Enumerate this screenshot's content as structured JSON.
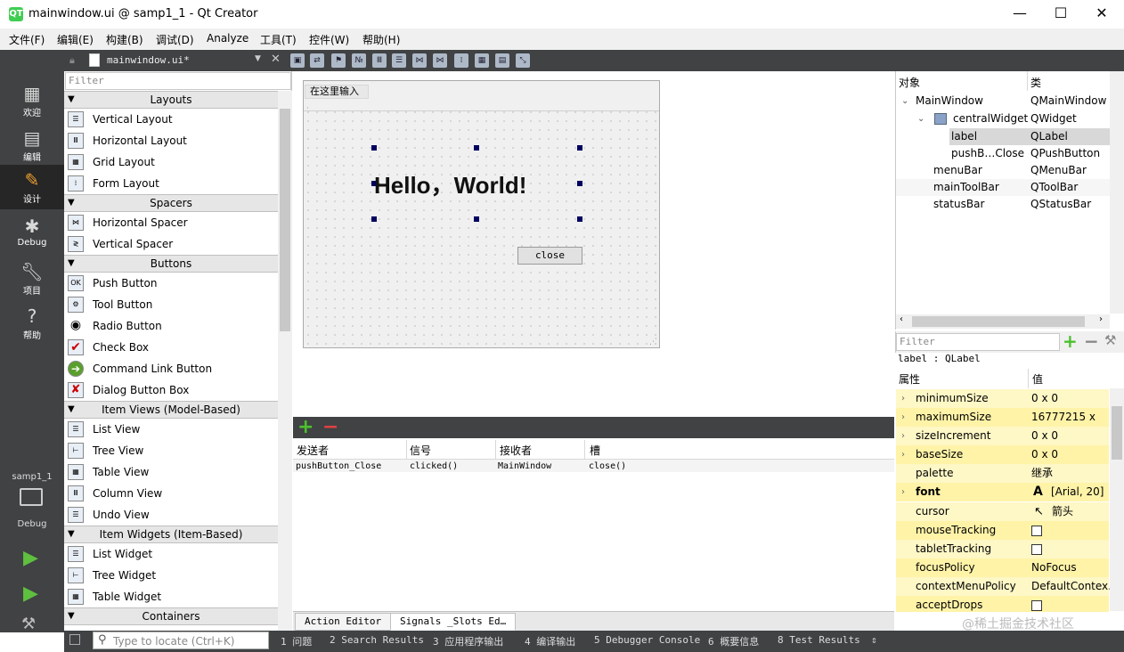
{
  "window": {
    "title": "mainwindow.ui @ samp1_1 - Qt Creator",
    "app_icon": "QT",
    "min": "—",
    "max": "☐",
    "close": "✕"
  },
  "menu": [
    "文件(F)",
    "编辑(E)",
    "构建(B)",
    "调试(D)",
    "Analyze",
    "工具(T)",
    "控件(W)",
    "帮助(H)"
  ],
  "modes": [
    {
      "label": "欢迎",
      "icon": "grid-icon"
    },
    {
      "label": "编辑",
      "icon": "doc-icon"
    },
    {
      "label": "设计",
      "icon": "pen-icon"
    },
    {
      "label": "Debug",
      "icon": "bug-icon"
    },
    {
      "label": "项目",
      "icon": "wrench-icon"
    },
    {
      "label": "帮助",
      "icon": "help-icon"
    }
  ],
  "kit": {
    "project": "samp1_1",
    "mode": "Debug"
  },
  "editor": {
    "file": "mainwindow.ui*"
  },
  "widgetbox": {
    "filter_placeholder": "Filter",
    "cat_layouts": "Layouts",
    "layouts": [
      "Vertical Layout",
      "Horizontal Layout",
      "Grid Layout",
      "Form Layout"
    ],
    "cat_spacers": "Spacers",
    "spacers": [
      "Horizontal Spacer",
      "Vertical Spacer"
    ],
    "cat_buttons": "Buttons",
    "buttons": [
      "Push Button",
      "Tool Button",
      "Radio Button",
      "Check Box",
      "Command Link Button",
      "Dialog Button Box"
    ],
    "cat_itemviews": "Item Views (Model-Based)",
    "itemviews": [
      "List View",
      "Tree View",
      "Table View",
      "Column View",
      "Undo View"
    ],
    "cat_itemwidgets": "Item Widgets (Item-Based)",
    "itemwidgets": [
      "List Widget",
      "Tree Widget",
      "Table Widget"
    ],
    "cat_containers": "Containers"
  },
  "form": {
    "menu_placeholder": "在这里输入",
    "label_text": "Hello，World!",
    "button_text": "close"
  },
  "signals": {
    "headers": [
      "发送者",
      "信号",
      "接收者",
      "槽"
    ],
    "row": [
      "pushButton_Close",
      "clicked()",
      "MainWindow",
      "close()"
    ],
    "add": "+",
    "remove": "−"
  },
  "bottom_tabs": [
    "Action Editor",
    "Signals _Slots Ed…"
  ],
  "object_inspector": {
    "headers": [
      "对象",
      "类"
    ],
    "rows": [
      {
        "name": "MainWindow",
        "cls": "QMainWindow"
      },
      {
        "name": "centralWidget",
        "cls": "QWidget"
      },
      {
        "name": "label",
        "cls": "QLabel"
      },
      {
        "name": "pushB…Close",
        "cls": "QPushButton"
      },
      {
        "name": "menuBar",
        "cls": "QMenuBar"
      },
      {
        "name": "mainToolBar",
        "cls": "QToolBar"
      },
      {
        "name": "statusBar",
        "cls": "QStatusBar"
      }
    ]
  },
  "property_editor": {
    "filter_placeholder": "Filter",
    "object_label": "label : QLabel",
    "headers": [
      "属性",
      "值"
    ],
    "rows": [
      {
        "name": "minimumSize",
        "value": "0 x 0"
      },
      {
        "name": "maximumSize",
        "value": "16777215 x 1…"
      },
      {
        "name": "sizeIncrement",
        "value": "0 x 0"
      },
      {
        "name": "baseSize",
        "value": "0 x 0"
      },
      {
        "name": "palette",
        "value": "继承"
      },
      {
        "name": "font",
        "value": "[Arial, 20]"
      },
      {
        "name": "cursor",
        "value": "箭头"
      },
      {
        "name": "mouseTracking",
        "value": ""
      },
      {
        "name": "tabletTracking",
        "value": ""
      },
      {
        "name": "focusPolicy",
        "value": "NoFocus"
      },
      {
        "name": "contextMenuPolicy",
        "value": "DefaultContex…"
      },
      {
        "name": "acceptDrops",
        "value": ""
      }
    ]
  },
  "statusbar": {
    "locate_placeholder": "Type to locate (Ctrl+K)",
    "panes": [
      "1 问题",
      "2 Search Results",
      "3 应用程序输出",
      "4 编译输出",
      "5 Debugger Console",
      "6 概要信息",
      "8 Test Results"
    ]
  },
  "watermark": "@稀土掘金技术社区"
}
